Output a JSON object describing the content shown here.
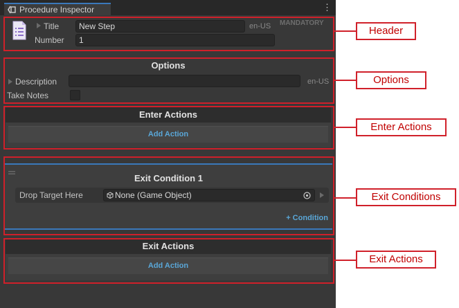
{
  "window": {
    "tab_title": "Procedure Inspector",
    "menu_glyph": "⋮"
  },
  "header": {
    "title_label": "Title",
    "title_value": "New Step",
    "title_locale": "en-US",
    "mandatory": "MANDATORY",
    "number_label": "Number",
    "number_value": "1"
  },
  "options": {
    "heading": "Options",
    "description_label": "Description",
    "description_value": "",
    "description_locale": "en-US",
    "take_notes_label": "Take Notes",
    "take_notes_checked": false
  },
  "enter_actions": {
    "heading": "Enter Actions",
    "add_label": "Add Action"
  },
  "exit_conditions": {
    "heading": "Exit Condition 1",
    "drop_label": "Drop Target Here",
    "drop_value": "None (Game Object)",
    "add_condition": "+ Condition"
  },
  "exit_actions": {
    "heading": "Exit Actions",
    "add_label": "Add Action"
  },
  "callouts": {
    "header": "Header",
    "options": "Options",
    "enter_actions": "Enter Actions",
    "exit_conditions": "Exit Conditions",
    "exit_actions": "Exit Actions"
  },
  "colors": {
    "accent": "#3a79bb",
    "link": "#5aa7d8",
    "annotation": "#d0202a"
  },
  "icons": [
    "inspector-icon",
    "document-icon",
    "object-icon",
    "target-icon",
    "drag-handle-icon"
  ]
}
